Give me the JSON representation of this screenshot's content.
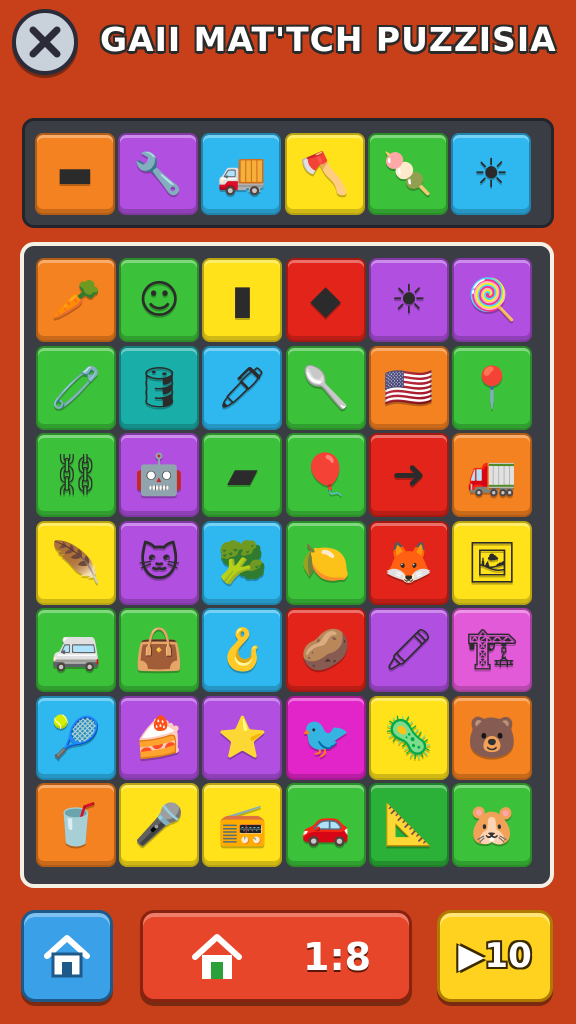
{
  "header": {
    "title": "GAII MAT'TCH PUZZISIA"
  },
  "tray": {
    "tiles": [
      {
        "color": "#f58220",
        "icon": "eraser-icon",
        "glyph": "▬"
      },
      {
        "color": "#b04fe0",
        "icon": "wrench-icon",
        "glyph": "🔧"
      },
      {
        "color": "#2fb8ef",
        "icon": "toy-truck-icon",
        "glyph": "🚚"
      },
      {
        "color": "#ffe21a",
        "icon": "axe-icon",
        "glyph": "🪓"
      },
      {
        "color": "#3cc23a",
        "icon": "popsicle-icon",
        "glyph": "🍡"
      },
      {
        "color": "#2fb8ef",
        "icon": "sun-icon",
        "glyph": "☀"
      }
    ]
  },
  "board": {
    "rows": [
      [
        {
          "color": "#f58220",
          "icon": "carrot-icon",
          "glyph": "🥕"
        },
        {
          "color": "#3cc23a",
          "icon": "pink-cup-face-icon",
          "glyph": "☺"
        },
        {
          "color": "#ffe21a",
          "icon": "usb-stick-icon",
          "glyph": "▮"
        },
        {
          "color": "#e2241a",
          "icon": "green-gem-icon",
          "glyph": "◆"
        },
        {
          "color": "#b04fe0",
          "icon": "sun-face-icon",
          "glyph": "☀"
        },
        {
          "color": "#b04fe0",
          "icon": "rainbow-lollipop-icon",
          "glyph": "🍭"
        }
      ],
      [
        {
          "color": "#3cc23a",
          "icon": "safety-pin-icon",
          "glyph": "🧷"
        },
        {
          "color": "#1aaea8",
          "icon": "barrel-icon",
          "glyph": "🛢"
        },
        {
          "color": "#2fb8ef",
          "icon": "pen-icon",
          "glyph": "🖊"
        },
        {
          "color": "#3cc23a",
          "icon": "spoon-icon",
          "glyph": "🥄"
        },
        {
          "color": "#f58220",
          "icon": "flag-icon",
          "glyph": "🇺🇸"
        },
        {
          "color": "#3cc23a",
          "icon": "map-pin-icon",
          "glyph": "📍"
        }
      ],
      [
        {
          "color": "#3cc23a",
          "icon": "conveyor-icon",
          "glyph": "⛓"
        },
        {
          "color": "#b04fe0",
          "icon": "toy-robot-icon",
          "glyph": "🤖"
        },
        {
          "color": "#3cc23a",
          "icon": "butter-block-icon",
          "glyph": "▰"
        },
        {
          "color": "#3cc23a",
          "icon": "balloon-icon",
          "glyph": "🎈"
        },
        {
          "color": "#e2241a",
          "icon": "arrow-right-icon",
          "glyph": "➜"
        },
        {
          "color": "#f58220",
          "icon": "red-truck-icon",
          "glyph": "🚛"
        }
      ],
      [
        {
          "color": "#ffe21a",
          "icon": "feather-icon",
          "glyph": "🪶"
        },
        {
          "color": "#b04fe0",
          "icon": "cat-face-icon",
          "glyph": "🐱"
        },
        {
          "color": "#2fb8ef",
          "icon": "broccoli-icon",
          "glyph": "🥦"
        },
        {
          "color": "#3cc23a",
          "icon": "lemon-icon",
          "glyph": "🍋"
        },
        {
          "color": "#e2241a",
          "icon": "fox-face-icon",
          "glyph": "🦊"
        },
        {
          "color": "#ffe21a",
          "icon": "picture-frame-icon",
          "glyph": "🖼"
        }
      ],
      [
        {
          "color": "#3cc23a",
          "icon": "green-van-icon",
          "glyph": "🚐"
        },
        {
          "color": "#3cc23a",
          "icon": "red-bag-icon",
          "glyph": "👜"
        },
        {
          "color": "#2fb8ef",
          "icon": "hook-icon",
          "glyph": "🪝"
        },
        {
          "color": "#e2241a",
          "icon": "orange-potato-icon",
          "glyph": "🥔"
        },
        {
          "color": "#b04fe0",
          "icon": "crayon-icon",
          "glyph": "🖍"
        },
        {
          "color": "#e25ad8",
          "icon": "toy-crane-icon",
          "glyph": "🏗"
        }
      ],
      [
        {
          "color": "#2fb8ef",
          "icon": "beach-ball-icon",
          "glyph": "🎾"
        },
        {
          "color": "#b04fe0",
          "icon": "cake-slice-icon",
          "glyph": "🍰"
        },
        {
          "color": "#b04fe0",
          "icon": "star-popsicle-icon",
          "glyph": "⭐"
        },
        {
          "color": "#e225c8",
          "icon": "bird-icon",
          "glyph": "🐦"
        },
        {
          "color": "#ffe21a",
          "icon": "green-virus-icon",
          "glyph": "🦠"
        },
        {
          "color": "#f58220",
          "icon": "bear-face-icon",
          "glyph": "🐻"
        }
      ],
      [
        {
          "color": "#f58220",
          "icon": "green-cup-icon",
          "glyph": "🥤"
        },
        {
          "color": "#ffe21a",
          "icon": "microphone-icon",
          "glyph": "🎤"
        },
        {
          "color": "#ffe21a",
          "icon": "purple-radio-icon",
          "glyph": "📻"
        },
        {
          "color": "#3cc23a",
          "icon": "pink-car-icon",
          "glyph": "🚗"
        },
        {
          "color": "#2bb038",
          "icon": "compass-icon",
          "glyph": "📐"
        },
        {
          "color": "#3cc23a",
          "icon": "hamster-icon",
          "glyph": "🐹"
        }
      ]
    ]
  },
  "footer": {
    "level_text": "1:8",
    "play_text": "▶10"
  }
}
